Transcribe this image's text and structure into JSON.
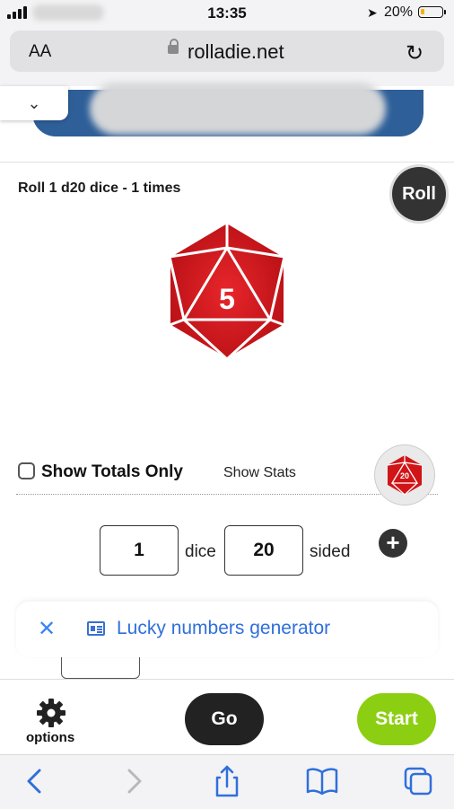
{
  "status_bar": {
    "time": "13:35",
    "battery_percent": "20%",
    "battery_level": 0.2,
    "battery_color": "#f2b400"
  },
  "browser": {
    "text_size_label": "AA",
    "url": "rolladie.net",
    "icons": [
      "lock-icon",
      "reload-icon",
      "back-icon",
      "forward-icon",
      "share-icon",
      "bookmarks-icon",
      "tabs-icon"
    ]
  },
  "roll": {
    "title": "Roll 1 d20 dice - 1 times",
    "button_label": "Roll",
    "result": "5",
    "die_color": "#d01418"
  },
  "options": {
    "show_totals_label": "Show Totals Only",
    "show_totals_checked": false,
    "show_stats_label": "Show Stats",
    "die_picker_value": "20"
  },
  "dice_config": {
    "dice_count": "1",
    "dice_label": "dice",
    "sides": "20",
    "sided_label": "sided",
    "add_icon": "plus-icon"
  },
  "popup": {
    "close_icon": "close-icon",
    "link_icon": "article-icon",
    "text": "Lucky numbers generator"
  },
  "bottom_bar": {
    "options_label": "options",
    "go_label": "Go",
    "start_label": "Start",
    "start_color": "#8ccf12"
  }
}
